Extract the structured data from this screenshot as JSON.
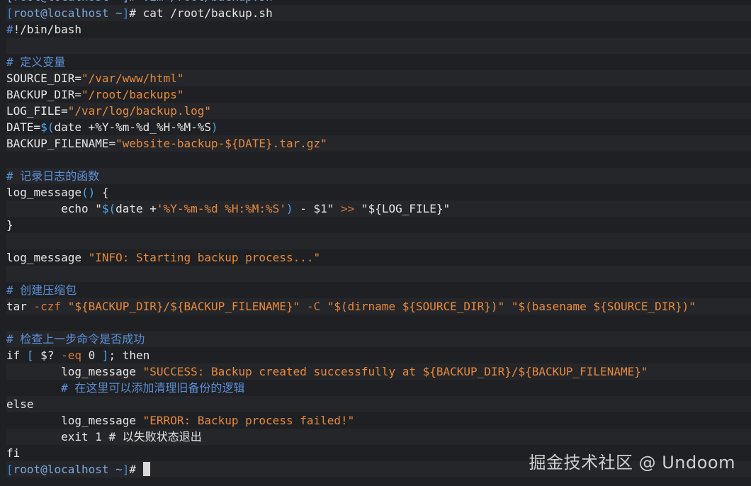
{
  "colors": {
    "default": "#e6e6e6",
    "comment": "#5c8fd6",
    "string": "#e78a3c",
    "operator": "#d8773a",
    "bracket": "#4aa8f0",
    "prompt_bracket": "#3f86d6",
    "prompt_user": "#7aa7e0"
  },
  "watermark": {
    "text": "掘金技术社区 @ Undoom"
  },
  "lines": [
    {
      "segments": [
        {
          "t": "[root@localhost ~]# vim /root/backup.sh",
          "c": "prompt_user"
        }
      ]
    },
    {
      "segments": [
        {
          "t": "[",
          "c": "prompt_bracket"
        },
        {
          "t": "root@localhost ~",
          "c": "prompt_user"
        },
        {
          "t": "]",
          "c": "prompt_bracket"
        },
        {
          "t": "# cat /root/backup.sh",
          "c": "default"
        }
      ]
    },
    {
      "segments": [
        {
          "t": "#",
          "c": "comment"
        },
        {
          "t": "!/bin/bash",
          "c": "default"
        }
      ]
    },
    {
      "segments": []
    },
    {
      "segments": [
        {
          "t": "# 定义变量",
          "c": "comment"
        }
      ]
    },
    {
      "segments": [
        {
          "t": "SOURCE_DIR=",
          "c": "default"
        },
        {
          "t": "\"/var/www/html\"",
          "c": "string"
        }
      ]
    },
    {
      "segments": [
        {
          "t": "BACKUP_DIR=",
          "c": "default"
        },
        {
          "t": "\"/root/backups\"",
          "c": "string"
        }
      ]
    },
    {
      "segments": [
        {
          "t": "LOG_FILE=",
          "c": "default"
        },
        {
          "t": "\"/var/log/backup.log\"",
          "c": "string"
        }
      ]
    },
    {
      "segments": [
        {
          "t": "DATE=",
          "c": "default"
        },
        {
          "t": "$(",
          "c": "bracket"
        },
        {
          "t": "date +%Y-%m-%d_%H-%M-%S",
          "c": "default"
        },
        {
          "t": ")",
          "c": "bracket"
        }
      ]
    },
    {
      "segments": [
        {
          "t": "BACKUP_FILENAME=",
          "c": "default"
        },
        {
          "t": "\"website-backup-${DATE}.tar.gz\"",
          "c": "string"
        }
      ]
    },
    {
      "segments": []
    },
    {
      "segments": [
        {
          "t": "# 记录日志的函数",
          "c": "comment"
        }
      ]
    },
    {
      "segments": [
        {
          "t": "log_message",
          "c": "default"
        },
        {
          "t": "()",
          "c": "bracket"
        },
        {
          "t": " {",
          "c": "default"
        }
      ]
    },
    {
      "segments": [
        {
          "t": "        echo \"",
          "c": "default"
        },
        {
          "t": "$(",
          "c": "bracket"
        },
        {
          "t": "date +",
          "c": "default"
        },
        {
          "t": "'%Y-%m-%d %H:%M:%S'",
          "c": "string"
        },
        {
          "t": ")",
          "c": "bracket"
        },
        {
          "t": " - $1\" ",
          "c": "default"
        },
        {
          "t": ">>",
          "c": "operator"
        },
        {
          "t": " \"${LOG_FILE}\"",
          "c": "default"
        }
      ]
    },
    {
      "segments": [
        {
          "t": "}",
          "c": "default"
        }
      ]
    },
    {
      "segments": []
    },
    {
      "segments": [
        {
          "t": "log_message ",
          "c": "default"
        },
        {
          "t": "\"INFO: Starting backup process...\"",
          "c": "string"
        }
      ]
    },
    {
      "segments": []
    },
    {
      "segments": [
        {
          "t": "# 创建压缩包",
          "c": "comment"
        }
      ]
    },
    {
      "segments": [
        {
          "t": "tar ",
          "c": "default"
        },
        {
          "t": "-czf",
          "c": "operator"
        },
        {
          "t": " \"${BACKUP_DIR}/${BACKUP_FILENAME}\" ",
          "c": "string"
        },
        {
          "t": "-C",
          "c": "operator"
        },
        {
          "t": " \"$(dirname ${SOURCE_DIR})\" \"$(basename ${SOURCE_DIR})\"",
          "c": "string"
        }
      ]
    },
    {
      "segments": []
    },
    {
      "segments": [
        {
          "t": "# 检查上一步命令是否成功",
          "c": "comment"
        }
      ]
    },
    {
      "segments": [
        {
          "t": "if ",
          "c": "default"
        },
        {
          "t": "[",
          "c": "bracket"
        },
        {
          "t": " $? ",
          "c": "default"
        },
        {
          "t": "-eq",
          "c": "operator"
        },
        {
          "t": " 0 ",
          "c": "default"
        },
        {
          "t": "]",
          "c": "bracket"
        },
        {
          "t": "; then",
          "c": "default"
        }
      ]
    },
    {
      "segments": [
        {
          "t": "        log_message ",
          "c": "default"
        },
        {
          "t": "\"SUCCESS: Backup created successfully at ${BACKUP_DIR}/${BACKUP_FILENAME}\"",
          "c": "string"
        }
      ]
    },
    {
      "segments": [
        {
          "t": "        # 在这里可以添加清理旧备份的逻辑",
          "c": "comment"
        }
      ]
    },
    {
      "segments": [
        {
          "t": "else",
          "c": "default"
        }
      ]
    },
    {
      "segments": [
        {
          "t": "        log_message ",
          "c": "default"
        },
        {
          "t": "\"ERROR: Backup process failed!\"",
          "c": "string"
        }
      ]
    },
    {
      "segments": [
        {
          "t": "        exit 1 ",
          "c": "default"
        },
        {
          "t": "# 以失败状态退出",
          "c": "default"
        }
      ]
    },
    {
      "segments": [
        {
          "t": "fi",
          "c": "default"
        }
      ]
    },
    {
      "segments": [
        {
          "t": "[",
          "c": "prompt_bracket"
        },
        {
          "t": "root@localhost ~",
          "c": "prompt_user"
        },
        {
          "t": "]",
          "c": "prompt_bracket"
        },
        {
          "t": "# ",
          "c": "default"
        }
      ],
      "cursor": true
    }
  ]
}
